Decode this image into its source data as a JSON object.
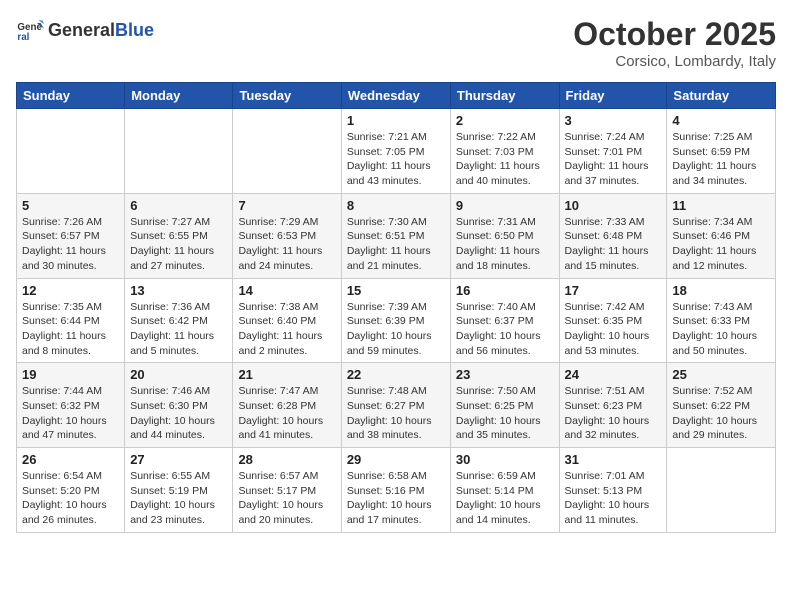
{
  "header": {
    "logo_general": "General",
    "logo_blue": "Blue",
    "month": "October 2025",
    "location": "Corsico, Lombardy, Italy"
  },
  "days_of_week": [
    "Sunday",
    "Monday",
    "Tuesday",
    "Wednesday",
    "Thursday",
    "Friday",
    "Saturday"
  ],
  "weeks": [
    [
      {
        "day": "",
        "info": ""
      },
      {
        "day": "",
        "info": ""
      },
      {
        "day": "",
        "info": ""
      },
      {
        "day": "1",
        "info": "Sunrise: 7:21 AM\nSunset: 7:05 PM\nDaylight: 11 hours and 43 minutes."
      },
      {
        "day": "2",
        "info": "Sunrise: 7:22 AM\nSunset: 7:03 PM\nDaylight: 11 hours and 40 minutes."
      },
      {
        "day": "3",
        "info": "Sunrise: 7:24 AM\nSunset: 7:01 PM\nDaylight: 11 hours and 37 minutes."
      },
      {
        "day": "4",
        "info": "Sunrise: 7:25 AM\nSunset: 6:59 PM\nDaylight: 11 hours and 34 minutes."
      }
    ],
    [
      {
        "day": "5",
        "info": "Sunrise: 7:26 AM\nSunset: 6:57 PM\nDaylight: 11 hours and 30 minutes."
      },
      {
        "day": "6",
        "info": "Sunrise: 7:27 AM\nSunset: 6:55 PM\nDaylight: 11 hours and 27 minutes."
      },
      {
        "day": "7",
        "info": "Sunrise: 7:29 AM\nSunset: 6:53 PM\nDaylight: 11 hours and 24 minutes."
      },
      {
        "day": "8",
        "info": "Sunrise: 7:30 AM\nSunset: 6:51 PM\nDaylight: 11 hours and 21 minutes."
      },
      {
        "day": "9",
        "info": "Sunrise: 7:31 AM\nSunset: 6:50 PM\nDaylight: 11 hours and 18 minutes."
      },
      {
        "day": "10",
        "info": "Sunrise: 7:33 AM\nSunset: 6:48 PM\nDaylight: 11 hours and 15 minutes."
      },
      {
        "day": "11",
        "info": "Sunrise: 7:34 AM\nSunset: 6:46 PM\nDaylight: 11 hours and 12 minutes."
      }
    ],
    [
      {
        "day": "12",
        "info": "Sunrise: 7:35 AM\nSunset: 6:44 PM\nDaylight: 11 hours and 8 minutes."
      },
      {
        "day": "13",
        "info": "Sunrise: 7:36 AM\nSunset: 6:42 PM\nDaylight: 11 hours and 5 minutes."
      },
      {
        "day": "14",
        "info": "Sunrise: 7:38 AM\nSunset: 6:40 PM\nDaylight: 11 hours and 2 minutes."
      },
      {
        "day": "15",
        "info": "Sunrise: 7:39 AM\nSunset: 6:39 PM\nDaylight: 10 hours and 59 minutes."
      },
      {
        "day": "16",
        "info": "Sunrise: 7:40 AM\nSunset: 6:37 PM\nDaylight: 10 hours and 56 minutes."
      },
      {
        "day": "17",
        "info": "Sunrise: 7:42 AM\nSunset: 6:35 PM\nDaylight: 10 hours and 53 minutes."
      },
      {
        "day": "18",
        "info": "Sunrise: 7:43 AM\nSunset: 6:33 PM\nDaylight: 10 hours and 50 minutes."
      }
    ],
    [
      {
        "day": "19",
        "info": "Sunrise: 7:44 AM\nSunset: 6:32 PM\nDaylight: 10 hours and 47 minutes."
      },
      {
        "day": "20",
        "info": "Sunrise: 7:46 AM\nSunset: 6:30 PM\nDaylight: 10 hours and 44 minutes."
      },
      {
        "day": "21",
        "info": "Sunrise: 7:47 AM\nSunset: 6:28 PM\nDaylight: 10 hours and 41 minutes."
      },
      {
        "day": "22",
        "info": "Sunrise: 7:48 AM\nSunset: 6:27 PM\nDaylight: 10 hours and 38 minutes."
      },
      {
        "day": "23",
        "info": "Sunrise: 7:50 AM\nSunset: 6:25 PM\nDaylight: 10 hours and 35 minutes."
      },
      {
        "day": "24",
        "info": "Sunrise: 7:51 AM\nSunset: 6:23 PM\nDaylight: 10 hours and 32 minutes."
      },
      {
        "day": "25",
        "info": "Sunrise: 7:52 AM\nSunset: 6:22 PM\nDaylight: 10 hours and 29 minutes."
      }
    ],
    [
      {
        "day": "26",
        "info": "Sunrise: 6:54 AM\nSunset: 5:20 PM\nDaylight: 10 hours and 26 minutes."
      },
      {
        "day": "27",
        "info": "Sunrise: 6:55 AM\nSunset: 5:19 PM\nDaylight: 10 hours and 23 minutes."
      },
      {
        "day": "28",
        "info": "Sunrise: 6:57 AM\nSunset: 5:17 PM\nDaylight: 10 hours and 20 minutes."
      },
      {
        "day": "29",
        "info": "Sunrise: 6:58 AM\nSunset: 5:16 PM\nDaylight: 10 hours and 17 minutes."
      },
      {
        "day": "30",
        "info": "Sunrise: 6:59 AM\nSunset: 5:14 PM\nDaylight: 10 hours and 14 minutes."
      },
      {
        "day": "31",
        "info": "Sunrise: 7:01 AM\nSunset: 5:13 PM\nDaylight: 10 hours and 11 minutes."
      },
      {
        "day": "",
        "info": ""
      }
    ]
  ]
}
